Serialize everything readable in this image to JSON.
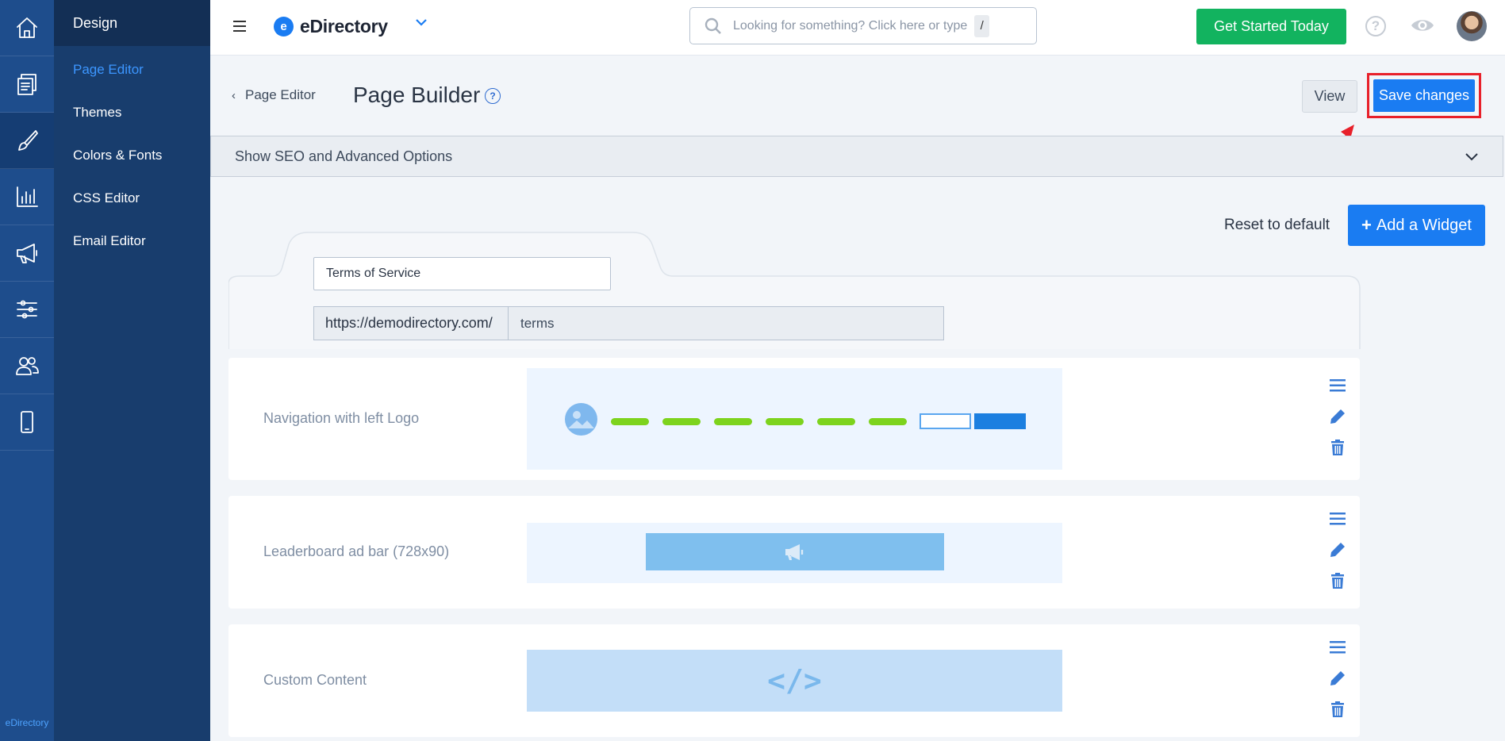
{
  "app": {
    "brand_footer": "eDirectory",
    "accent": "#1a7cf2",
    "highlight": "#e8202a"
  },
  "rail": {
    "items": [
      {
        "name": "home-icon",
        "active": false
      },
      {
        "name": "pages-icon",
        "active": false
      },
      {
        "name": "brush-icon",
        "active": true
      },
      {
        "name": "chart-icon",
        "active": false
      },
      {
        "name": "megaphone-icon",
        "active": false
      },
      {
        "name": "sliders-icon",
        "active": false
      },
      {
        "name": "users-icon",
        "active": false
      },
      {
        "name": "mobile-icon",
        "active": false
      }
    ]
  },
  "sidenav": {
    "title": "Design",
    "items": [
      {
        "label": "Page Editor",
        "active": true
      },
      {
        "label": "Themes",
        "active": false
      },
      {
        "label": "Colors & Fonts",
        "active": false
      },
      {
        "label": "CSS Editor",
        "active": false
      },
      {
        "label": "Email Editor",
        "active": false
      }
    ]
  },
  "topbar": {
    "logo_mark": "e",
    "logo_text": "eDirectory",
    "search_placeholder": "Looking for something? Click here or type",
    "search_shortcut": "/",
    "cta_label": "Get Started Today",
    "help_label": "?"
  },
  "header": {
    "breadcrumb": "Page Editor",
    "title": "Page Builder",
    "title_help": "?",
    "view_label": "View",
    "save_label": "Save changes"
  },
  "seo": {
    "label": "Show SEO and Advanced Options"
  },
  "toolbar": {
    "reset_label": "Reset to default",
    "add_widget_label": "Add a Widget",
    "add_widget_plus": "+"
  },
  "page_form": {
    "title_value": "Terms of Service",
    "url_prefix": "https://demodirectory.com/",
    "url_slug": "terms"
  },
  "widgets": [
    {
      "label": "Navigation with left Logo",
      "preview": "navigation"
    },
    {
      "label": "Leaderboard ad bar (728x90)",
      "preview": "leaderboard"
    },
    {
      "label": "Custom Content",
      "preview": "custom",
      "preview_symbol": "</>"
    }
  ]
}
